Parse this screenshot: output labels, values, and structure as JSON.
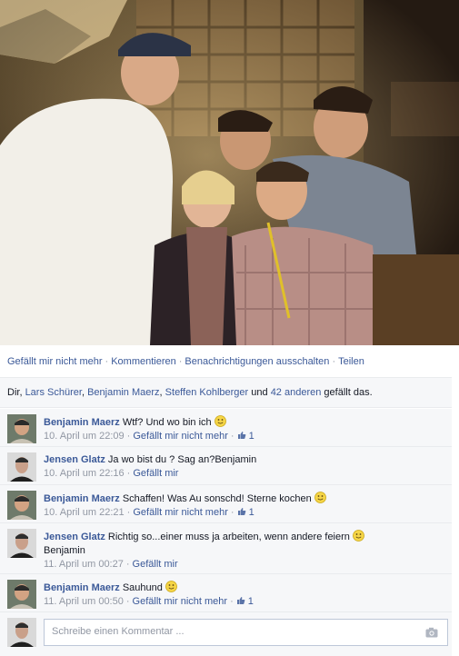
{
  "actions": {
    "unlike": "Gefällt mir nicht mehr",
    "comment": "Kommentieren",
    "notifications_off": "Benachrichtigungen ausschalten",
    "share": "Teilen",
    "separator": "·"
  },
  "likes": {
    "prefix": "Dir,",
    "names": [
      "Lars Schürer",
      "Benjamin Maerz",
      "Steffen Kohlberger"
    ],
    "connector": "und",
    "others_link": "42 anderen",
    "suffix": "gefällt das."
  },
  "comments": [
    {
      "author": "Benjamin Maerz",
      "text": "Wtf? Und wo bin ich",
      "tag": "",
      "emoji": "smiley-emoji",
      "time": "10. April um 22:09",
      "like_action": "Gefällt mir nicht mehr",
      "like_count": "1",
      "avatar": "bm"
    },
    {
      "author": "Jensen Glatz",
      "text": "Ja wo bist du ? Sag an?",
      "tag": "Benjamin",
      "emoji": "",
      "time": "10. April um 22:16",
      "like_action": "Gefällt mir",
      "like_count": "",
      "avatar": "jg"
    },
    {
      "author": "Benjamin Maerz",
      "text": "Schaffen! Was Au sonschd! Sterne kochen",
      "tag": "",
      "emoji": "smiley-emoji",
      "time": "10. April um 22:21",
      "like_action": "Gefällt mir nicht mehr",
      "like_count": "1",
      "avatar": "bm"
    },
    {
      "author": "Jensen Glatz",
      "text": "Richtig so...einer muss ja arbeiten, wenn andere feiern",
      "tag": "Benjamin",
      "emoji": "smiley-emoji",
      "time": "11. April um 00:27",
      "like_action": "Gefällt mir",
      "like_count": "",
      "avatar": "jg"
    },
    {
      "author": "Benjamin Maerz",
      "text": "Sauhund",
      "tag": "",
      "emoji": "smiley-emoji",
      "time": "11. April um 00:50",
      "like_action": "Gefällt mir nicht mehr",
      "like_count": "1",
      "avatar": "bm"
    }
  ],
  "composer": {
    "placeholder": "Schreibe einen Kommentar ...",
    "icon": "camera-icon"
  },
  "colors": {
    "link": "#3b5998",
    "muted": "#9197a3",
    "panel": "#f6f7f9",
    "border": "#e9ebee"
  }
}
